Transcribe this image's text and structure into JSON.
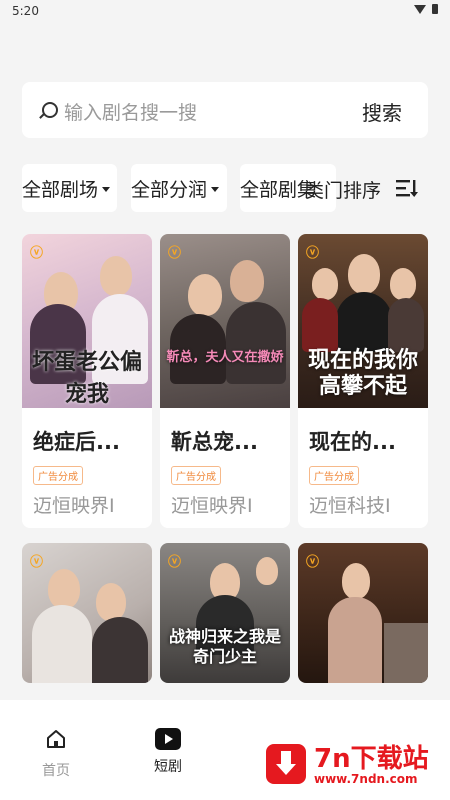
{
  "status_bar": {
    "time": "5:20"
  },
  "search": {
    "placeholder": "输入剧名搜一搜",
    "button": "搜索"
  },
  "filters": {
    "chips": [
      "全部剧场",
      "全部分润",
      "全部剧集"
    ],
    "sort_label": "类门排序"
  },
  "cards": [
    {
      "title": "绝症后...",
      "badge": "广告分成",
      "publisher": "迈恒映界I",
      "poster_text": "坏蛋老公偏宠我"
    },
    {
      "title": "靳总宠...",
      "badge": "广告分成",
      "publisher": "迈恒映界I",
      "poster_text": "靳总，夫人又在撒娇"
    },
    {
      "title": "现在的...",
      "badge": "广告分成",
      "publisher": "迈恒科技I",
      "poster_text": "现在的我你高攀不起"
    },
    {
      "title": "",
      "badge": "",
      "publisher": "",
      "poster_text": ""
    },
    {
      "title": "",
      "badge": "",
      "publisher": "",
      "poster_text": "战神归来之我是奇门少主"
    },
    {
      "title": "",
      "badge": "",
      "publisher": "",
      "poster_text": ""
    }
  ],
  "tabbar": {
    "home": "首页",
    "shorts": "短剧"
  },
  "watermark": {
    "title": "7n下载站",
    "url": "www.7ndn.com"
  },
  "colors": {
    "accent": "#f5a623",
    "badge": "#f08a3c",
    "watermark": "#e5191f"
  }
}
